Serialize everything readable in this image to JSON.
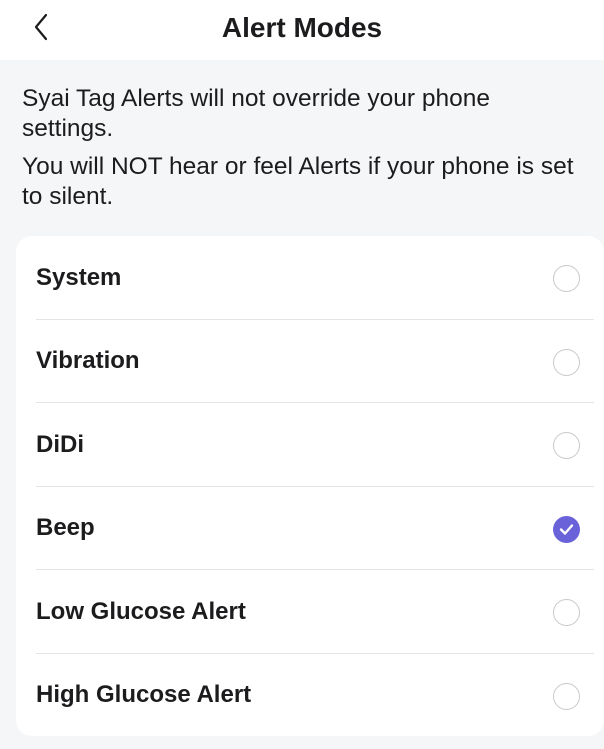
{
  "header": {
    "title": "Alert Modes",
    "back_icon": "chevron-left-icon"
  },
  "info": {
    "line1": "Syai Tag Alerts will not override your phone settings.",
    "line2": "You will NOT hear or feel Alerts if your phone is set to silent."
  },
  "options": [
    {
      "label": "System",
      "selected": false
    },
    {
      "label": "Vibration",
      "selected": false
    },
    {
      "label": "DiDi",
      "selected": false
    },
    {
      "label": "Beep",
      "selected": true
    },
    {
      "label": "Low Glucose Alert",
      "selected": false
    },
    {
      "label": "High Glucose Alert",
      "selected": false
    }
  ],
  "colors": {
    "accent": "#6a62d8",
    "background": "#f5f6f8",
    "card": "#ffffff",
    "radio_border": "#c9c9cd"
  }
}
